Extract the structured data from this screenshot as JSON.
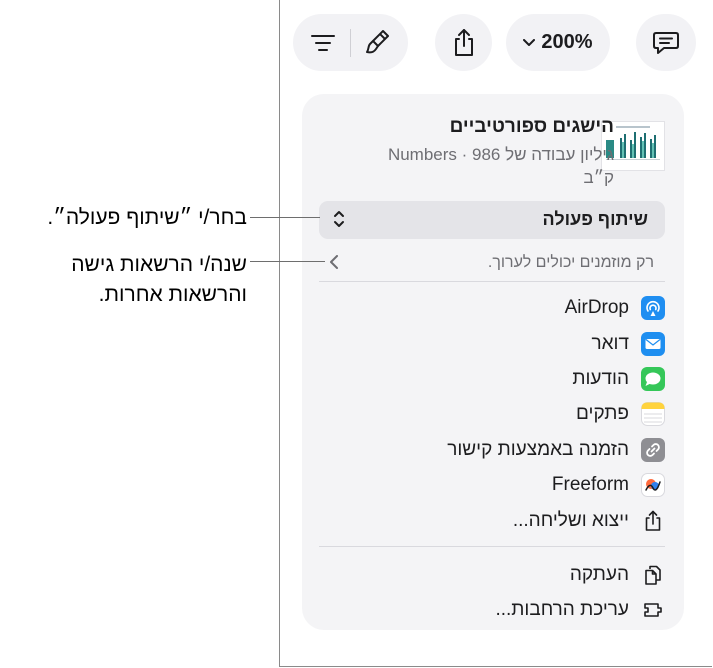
{
  "toolbar": {
    "format_icon": "format-lines-icon",
    "paintbrush_icon": "paintbrush-icon",
    "share_icon": "share-icon",
    "zoom_label": "200%",
    "zoom_chevron_icon": "chevron-down-icon",
    "comment_icon": "comment-icon"
  },
  "document": {
    "title": "הישגים ספורטיביים",
    "subtitle": "גיליון עבודה של Numbers · 986 ק״ב"
  },
  "collaboration": {
    "label": "שיתוף פעולה",
    "permission_text": "רק מוזמנים יכולים לערוך."
  },
  "share_options": [
    {
      "label": "AirDrop",
      "icon": "airdrop-icon",
      "color": "#1f8ef1"
    },
    {
      "label": "דואר",
      "icon": "mail-icon",
      "color": "#1e8ef0"
    },
    {
      "label": "הודעות",
      "icon": "messages-icon",
      "color": "#35c759"
    },
    {
      "label": "פתקים",
      "icon": "notes-icon",
      "color": "#ffd33d"
    },
    {
      "label": "הזמנה באמצעות קישור",
      "icon": "link-icon",
      "color": "#8e8e93"
    },
    {
      "label": "Freeform",
      "icon": "freeform-icon",
      "color": "#ff6a3d"
    },
    {
      "label": "ייצוא ושליחה...",
      "icon": "export-icon",
      "color": "#1d1d1f"
    }
  ],
  "more_options": [
    {
      "label": "העתקה",
      "icon": "copy-icon"
    },
    {
      "label": "עריכת הרחבות...",
      "icon": "extensions-icon"
    }
  ],
  "callouts": {
    "choose_collab": "בחר/י ״שיתוף פעולה״.",
    "change_permissions_line1": "שנה/י הרשאות גישה",
    "change_permissions_line2": "והרשאות אחרות."
  }
}
